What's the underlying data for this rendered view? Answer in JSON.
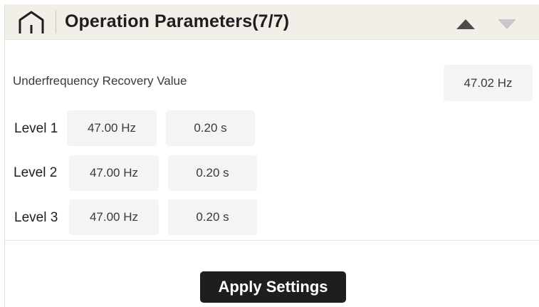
{
  "header": {
    "title": "Operation Parameters(7/7)",
    "home_icon": "home-icon",
    "prev_icon": "triangle-up-icon",
    "next_icon": "triangle-down-icon",
    "prev_color": "#4d4d4d",
    "next_color": "#c8c8c8"
  },
  "recovery": {
    "label": "Underfrequency Recovery Value",
    "value": "47.02 Hz"
  },
  "levels": [
    {
      "label": "Level 1",
      "frequency": "47.00 Hz",
      "time": "0.20 s"
    },
    {
      "label": "Level 2",
      "frequency": "47.00 Hz",
      "time": "0.20 s"
    },
    {
      "label": "Level 3",
      "frequency": "47.00 Hz",
      "time": "0.20 s"
    }
  ],
  "footer": {
    "apply_label": "Apply Settings"
  },
  "colors": {
    "header_bg": "#f2efe8",
    "field_bg": "#f4f4f4",
    "button_bg": "#1e1e1e",
    "button_text": "#ffffff"
  }
}
